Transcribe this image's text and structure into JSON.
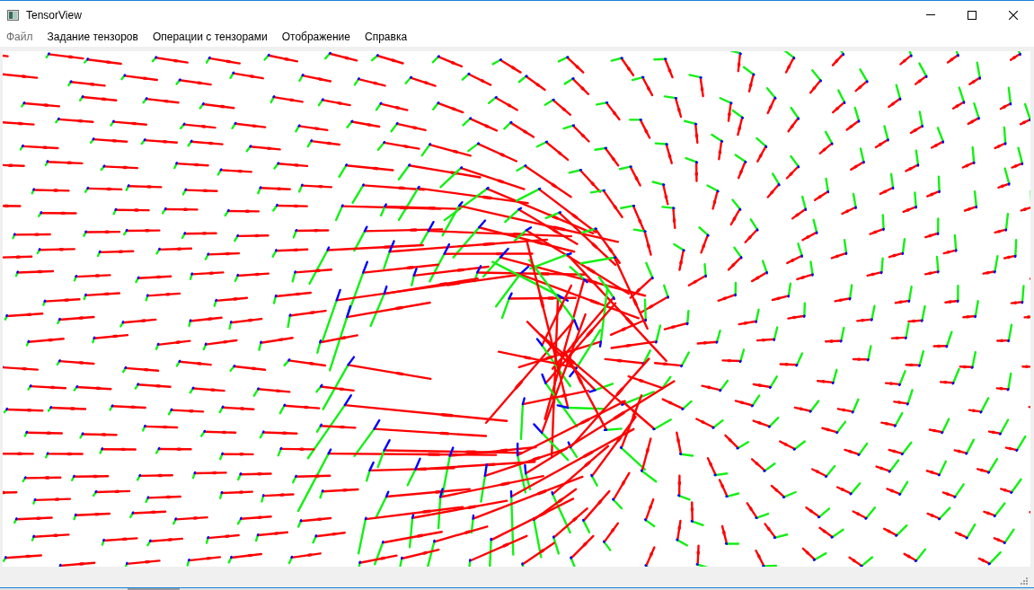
{
  "window": {
    "title": "TensorView"
  },
  "menu": [
    {
      "label": "Файл",
      "disabled": true
    },
    {
      "label": "Задание тензоров",
      "disabled": false
    },
    {
      "label": "Операции с тензорами",
      "disabled": false
    },
    {
      "label": "Отображение",
      "disabled": false
    },
    {
      "label": "Справка",
      "disabled": false
    }
  ]
}
